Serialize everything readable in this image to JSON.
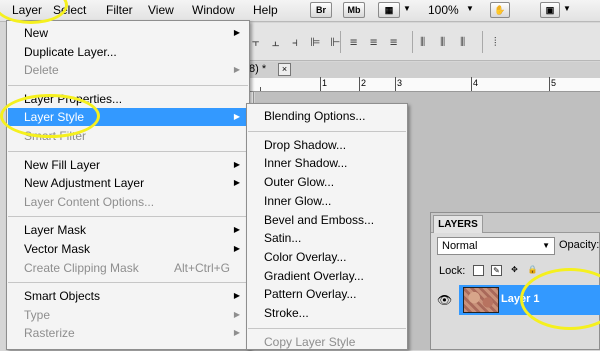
{
  "menubar": {
    "items": [
      "Layer",
      "Select",
      "Filter",
      "View",
      "Window",
      "Help"
    ],
    "icons": [
      "Br",
      "Mb"
    ],
    "zoom": "100%"
  },
  "document": {
    "title": "/8) *",
    "close": "×"
  },
  "ruler": {
    "labels": [
      "1",
      "2",
      "3",
      "4",
      "5"
    ]
  },
  "layer_menu": {
    "items": [
      {
        "label": "New",
        "arrow": true,
        "disabled": false
      },
      {
        "label": "Duplicate Layer...",
        "disabled": false
      },
      {
        "label": "Delete",
        "arrow": true,
        "disabled": true
      },
      {
        "sep": true
      },
      {
        "label": "Layer Properties...",
        "disabled": false
      },
      {
        "label": "Layer Style",
        "arrow": true,
        "disabled": false,
        "highlight": true
      },
      {
        "label": "Smart Filter",
        "disabled": true
      },
      {
        "sep": true
      },
      {
        "label": "New Fill Layer",
        "arrow": true,
        "disabled": false
      },
      {
        "label": "New Adjustment Layer",
        "arrow": true,
        "disabled": false
      },
      {
        "label": "Layer Content Options...",
        "disabled": true
      },
      {
        "sep": true
      },
      {
        "label": "Layer Mask",
        "arrow": true,
        "disabled": false
      },
      {
        "label": "Vector Mask",
        "arrow": true,
        "disabled": false
      },
      {
        "label": "Create Clipping Mask",
        "shortcut": "Alt+Ctrl+G",
        "disabled": true
      },
      {
        "sep": true
      },
      {
        "label": "Smart Objects",
        "arrow": true,
        "disabled": false
      },
      {
        "label": "Type",
        "arrow": true,
        "disabled": true
      },
      {
        "label": "Rasterize",
        "arrow": true,
        "disabled": true
      }
    ]
  },
  "layer_style_menu": {
    "items": [
      {
        "label": "Blending Options...",
        "disabled": false
      },
      {
        "sep": true
      },
      {
        "label": "Drop Shadow...",
        "disabled": false
      },
      {
        "label": "Inner Shadow...",
        "disabled": false
      },
      {
        "label": "Outer Glow...",
        "disabled": false
      },
      {
        "label": "Inner Glow...",
        "disabled": false
      },
      {
        "label": "Bevel and Emboss...",
        "disabled": false
      },
      {
        "label": "Satin...",
        "disabled": false
      },
      {
        "label": "Color Overlay...",
        "disabled": false
      },
      {
        "label": "Gradient Overlay...",
        "disabled": false
      },
      {
        "label": "Pattern Overlay...",
        "disabled": false
      },
      {
        "label": "Stroke...",
        "disabled": false
      },
      {
        "sep": true
      },
      {
        "label": "Copy Layer Style",
        "disabled": true
      }
    ]
  },
  "layers_panel": {
    "tab": "LAYERS",
    "blend_mode": "Normal",
    "opacity_label": "Opacity:",
    "lock_label": "Lock:",
    "layer_name": "Layer 1"
  },
  "colors": {
    "highlight": "#3399ff",
    "annotation": "#f5f01e"
  }
}
